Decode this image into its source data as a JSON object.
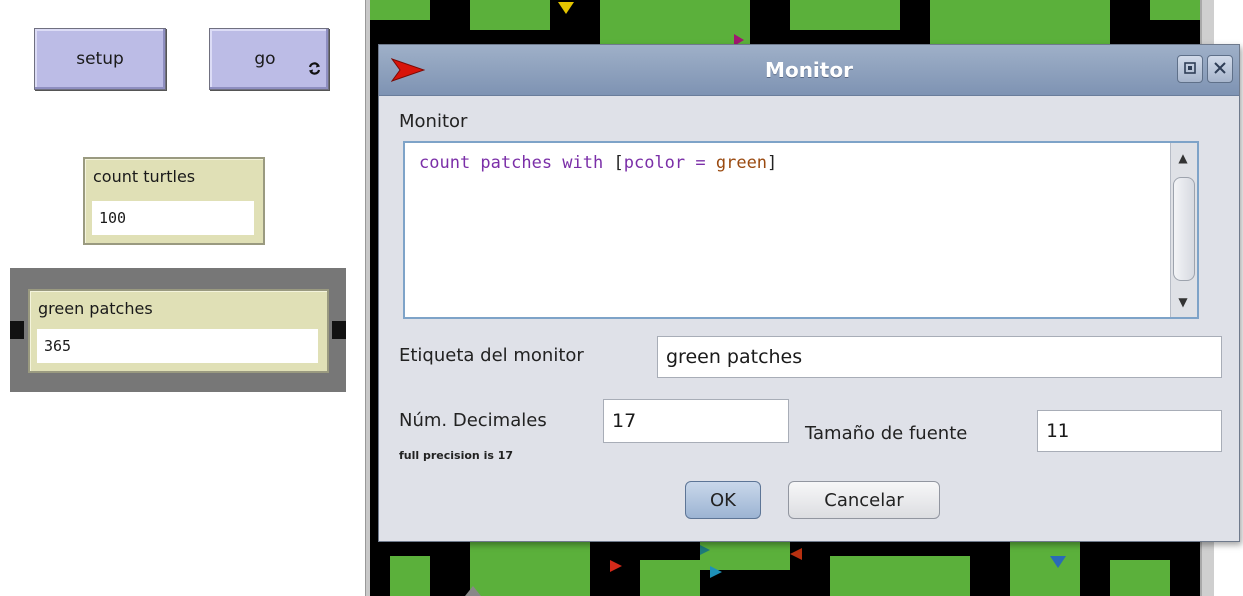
{
  "interface": {
    "setup_button": "setup",
    "go_button": "go",
    "monitors": [
      {
        "label": "count turtles",
        "value": "100"
      },
      {
        "label": "green patches",
        "value": "365"
      }
    ]
  },
  "colors": {
    "button_bg": "#bcbce6",
    "monitor_bg": "#e0e0b6",
    "patch_green": "#5bb03b",
    "titlebar": "#8a9dbc",
    "code_keyword": "#7b2fa8",
    "code_literal": "#9a4a10"
  },
  "icons": {
    "forever": "forever-loop-icon",
    "logo": "netlogo-logo-icon",
    "maximize": "maximize-icon",
    "close": "close-icon",
    "scroll_up": "scroll-up-arrow-icon",
    "scroll_down": "scroll-down-arrow-icon"
  },
  "dialog": {
    "title": "Monitor",
    "reporter_label": "Monitor",
    "code": {
      "part1": "count patches with ",
      "bracket_open": "[",
      "part2": "pcolor",
      "op": " = ",
      "literal": "green",
      "bracket_close": "]"
    },
    "display_name_label": "Etiqueta del monitor",
    "display_name_value": "green patches",
    "decimals_label": "Núm. Decimales",
    "decimals_value": "17",
    "precision_hint": "full precision is 17",
    "font_size_label": "Tamaño de fuente",
    "font_size_value": "11",
    "ok_button": "OK",
    "cancel_button": "Cancelar"
  }
}
